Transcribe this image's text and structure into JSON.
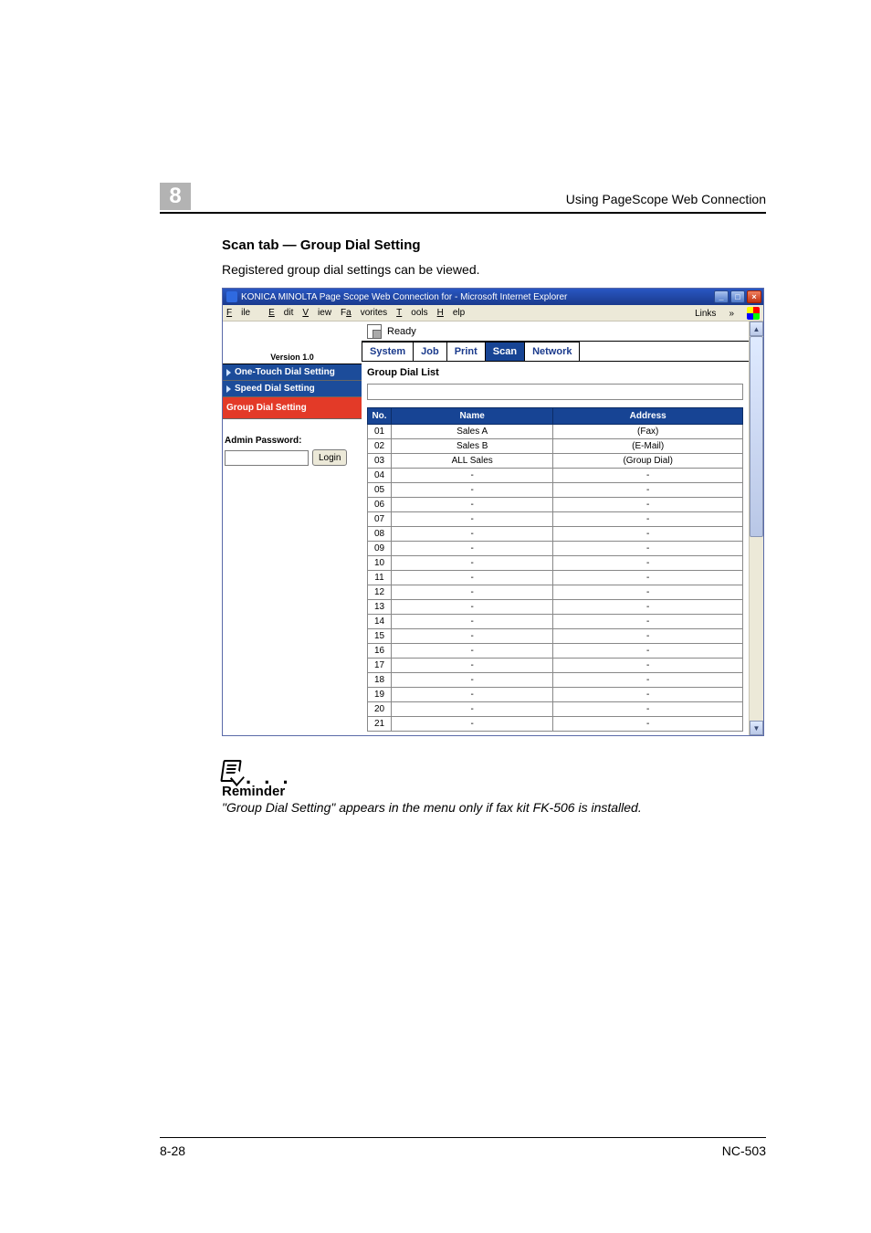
{
  "chapter_number": "8",
  "running_head": "Using PageScope Web Connection",
  "section_heading": "Scan tab — Group Dial Setting",
  "intro_text": "Registered group dial settings can be viewed.",
  "browser_title": "KONICA MINOLTA Page Scope Web Connection for        - Microsoft Internet Explorer",
  "menubar": {
    "file": "File",
    "edit": "Edit",
    "view": "View",
    "favorites": "Favorites",
    "tools": "Tools",
    "help": "Help",
    "links": "Links"
  },
  "left_panel": {
    "version": "Version 1.0",
    "items": [
      {
        "label": "One-Touch Dial Setting",
        "style": "blue"
      },
      {
        "label": "Speed Dial Setting",
        "style": "blue"
      },
      {
        "label": "Group Dial Setting",
        "style": "red"
      }
    ],
    "admin_label": "Admin Password:",
    "login_label": "Login"
  },
  "status_text": "Ready",
  "tabs": [
    "System",
    "Job",
    "Print",
    "Scan",
    "Network"
  ],
  "active_tab_index": 3,
  "panel_title": "Group Dial List",
  "columns": [
    "No.",
    "Name",
    "Address"
  ],
  "rows": [
    {
      "no": "01",
      "name": "Sales A",
      "address": "(Fax)"
    },
    {
      "no": "02",
      "name": "Sales B",
      "address": "(E-Mail)"
    },
    {
      "no": "03",
      "name": "ALL Sales",
      "address": "(Group Dial)"
    },
    {
      "no": "04",
      "name": "-",
      "address": "-"
    },
    {
      "no": "05",
      "name": "-",
      "address": "-"
    },
    {
      "no": "06",
      "name": "-",
      "address": "-"
    },
    {
      "no": "07",
      "name": "-",
      "address": "-"
    },
    {
      "no": "08",
      "name": "-",
      "address": "-"
    },
    {
      "no": "09",
      "name": "-",
      "address": "-"
    },
    {
      "no": "10",
      "name": "-",
      "address": "-"
    },
    {
      "no": "11",
      "name": "-",
      "address": "-"
    },
    {
      "no": "12",
      "name": "-",
      "address": "-"
    },
    {
      "no": "13",
      "name": "-",
      "address": "-"
    },
    {
      "no": "14",
      "name": "-",
      "address": "-"
    },
    {
      "no": "15",
      "name": "-",
      "address": "-"
    },
    {
      "no": "16",
      "name": "-",
      "address": "-"
    },
    {
      "no": "17",
      "name": "-",
      "address": "-"
    },
    {
      "no": "18",
      "name": "-",
      "address": "-"
    },
    {
      "no": "19",
      "name": "-",
      "address": "-"
    },
    {
      "no": "20",
      "name": "-",
      "address": "-"
    },
    {
      "no": "21",
      "name": "-",
      "address": "-"
    }
  ],
  "note": {
    "dots": ". . .",
    "title": "Reminder",
    "body": "\"Group Dial Setting\" appears in the menu only if fax kit FK-506 is installed."
  },
  "footer": {
    "left": "8-28",
    "right": "NC-503"
  }
}
